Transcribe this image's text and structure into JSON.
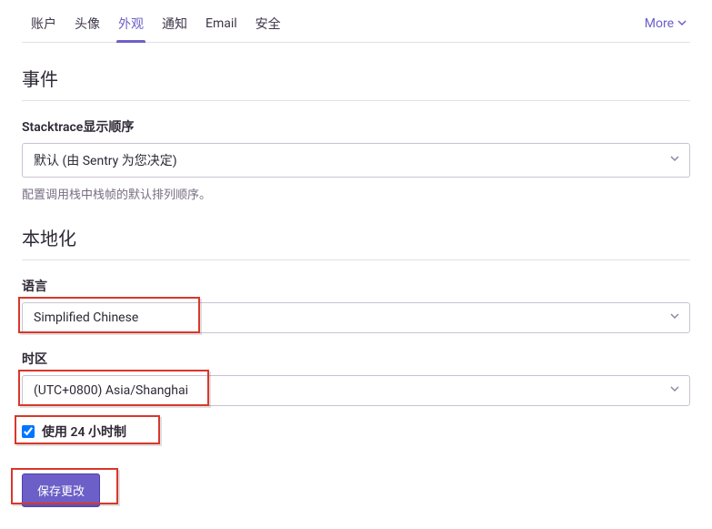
{
  "tabs": {
    "items": [
      {
        "label": "账户"
      },
      {
        "label": "头像"
      },
      {
        "label": "外观"
      },
      {
        "label": "通知"
      },
      {
        "label": "Email"
      },
      {
        "label": "安全"
      }
    ],
    "active_index": 2,
    "more_label": "More"
  },
  "sections": {
    "events": {
      "title": "事件"
    },
    "localization": {
      "title": "本地化"
    }
  },
  "fields": {
    "stacktrace_order": {
      "label": "Stacktrace显示顺序",
      "value": "默认 (由 Sentry 为您决定)",
      "help": "配置调用栈中栈帧的默认排列顺序。"
    },
    "language": {
      "label": "语言",
      "value": "Simplified Chinese"
    },
    "timezone": {
      "label": "时区",
      "value": "(UTC+0800) Asia/Shanghai"
    },
    "clock24": {
      "label": "使用 24 小时制",
      "checked": true
    }
  },
  "buttons": {
    "save": "保存更改"
  }
}
